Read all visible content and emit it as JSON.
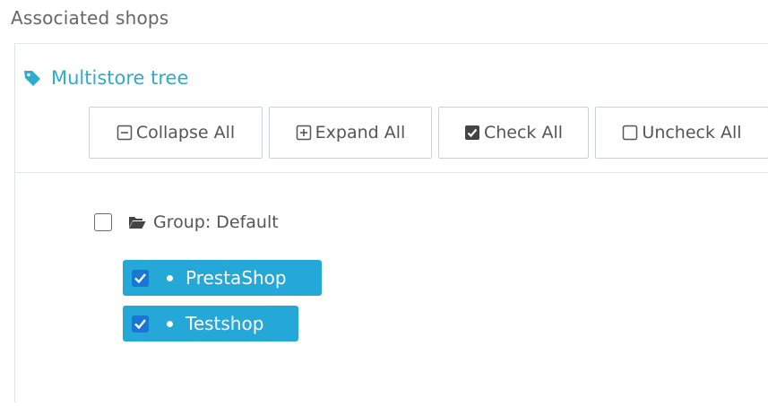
{
  "section": {
    "label": "Associated shops"
  },
  "tree": {
    "title": "Multistore tree",
    "title_icon": "tag-icon",
    "accent_color": "#2eacce",
    "buttons": {
      "collapse": {
        "label": "Collapse All",
        "icon": "minus-square-icon"
      },
      "expand": {
        "label": "Expand All",
        "icon": "plus-square-icon"
      },
      "check": {
        "label": "Check All",
        "icon": "check-square-icon"
      },
      "uncheck": {
        "label": "Uncheck All",
        "icon": "empty-square-icon"
      }
    },
    "group": {
      "label": "Group: Default",
      "checked": false,
      "icon": "folder-open-icon"
    },
    "shops": [
      {
        "label": "PrestaShop",
        "checked": true
      },
      {
        "label": "Testshop",
        "checked": true
      }
    ],
    "selected_color": "#25a7d8"
  }
}
